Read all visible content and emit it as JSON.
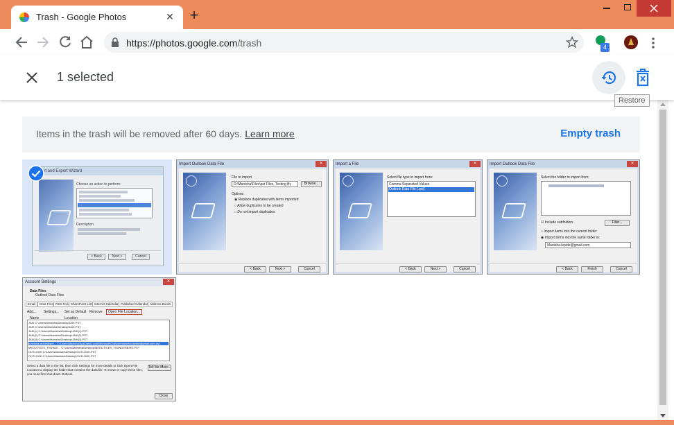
{
  "tab": {
    "title": "Trash - Google Photos",
    "close": "✕",
    "new_tab": "+"
  },
  "address": {
    "origin": "https://photos.google.com",
    "path": "/trash"
  },
  "extension": {
    "badge": "4"
  },
  "selection_bar": {
    "count_label": "1 selected",
    "restore_tooltip": "Restore"
  },
  "notice": {
    "message": "Items in the trash will be removed after 60 days.",
    "learn_more": "Learn more",
    "empty_trash": "Empty trash"
  },
  "photos": [
    {
      "title": "Import and Export Wizard",
      "lines": [
        "Choose an action to perform:",
        "Description"
      ],
      "buttons": [
        "< Back",
        "Next >",
        "Cancel"
      ],
      "selected": true
    },
    {
      "title": "Import Outlook Data File",
      "lines": [
        "File to import",
        "D:\\Manisha\\Files\\pst Files, Testing By",
        "Options",
        "Replace duplicates with items imported",
        "Allow duplicates to be created",
        "Do not import duplicates"
      ],
      "buttons": [
        "Browse...",
        "< Back",
        "Next >",
        "Cancel"
      ]
    },
    {
      "title": "Import a File",
      "lines": [
        "Select file type to import from:",
        "Comma Separated Values",
        "Outlook Data File (.pst)"
      ],
      "buttons": [
        "< Back",
        "Next >",
        "Cancel"
      ]
    },
    {
      "title": "Import Outlook Data File",
      "lines": [
        "Select the folder to import from:",
        "Include subfolders",
        "Import items into the current folder",
        "Import items into the same folder in:",
        "Manisha.lepide@gmail.com"
      ],
      "buttons": [
        "Filter...",
        "< Back",
        "Finish",
        "Cancel"
      ]
    },
    {
      "title": "Account Settings",
      "lines": [
        "Data Files",
        "Outlook Data Files",
        "Name",
        "Location"
      ],
      "tabs": [
        "Email",
        "Data Files",
        "RSS Feeds",
        "SharePoint Lists",
        "Internet Calendars",
        "Published Calendars",
        "Address Books"
      ],
      "toolbar": [
        "Add...",
        "Settings...",
        "Set as Default",
        "Remove",
        "Open File Location..."
      ],
      "rows": [
        "JAIK                C:\\Users\\Manisha\\Desktop\\JAIK.PST",
        "JAIK                C:\\Users\\Manisha\\Desktop\\JAIK.PST",
        "JAIK(1)             C:\\Users\\Manisha\\Desktop\\JAIK(1).PST",
        "JAIK(2)             C:\\Users\\Manisha\\Desktop\\JAIK(2).PST",
        "JAIK(3)             C:\\Users\\Manisha\\Desktop\\JAIK(3).PST",
        "manisha.lepide@gm...  C:\\Users\\Manisha\\AppData\\Local\\Microsoft\\Outlook\\manisha.lepide@gmail.com.ost",
        "MEDU FILES_THUNDE...  C:\\Users\\Manisha\\Desktop\\MEDU FILES_THUNDERBIRD.PST",
        "OUTLOOK             C:\\Users\\Manisha\\Desktop\\OUTLOOK.PST",
        "OUTLOOK             C:\\Users\\Manisha\\Desktop\\OUTLOOK.PST"
      ],
      "footer": "Select a data file in the list, then click Settings for more details or click Open File Location to display the folder that contains the data file. To move or copy these files, you must first shut down Outlook.",
      "buttons": [
        "Tell Me More...",
        "Close"
      ]
    }
  ]
}
